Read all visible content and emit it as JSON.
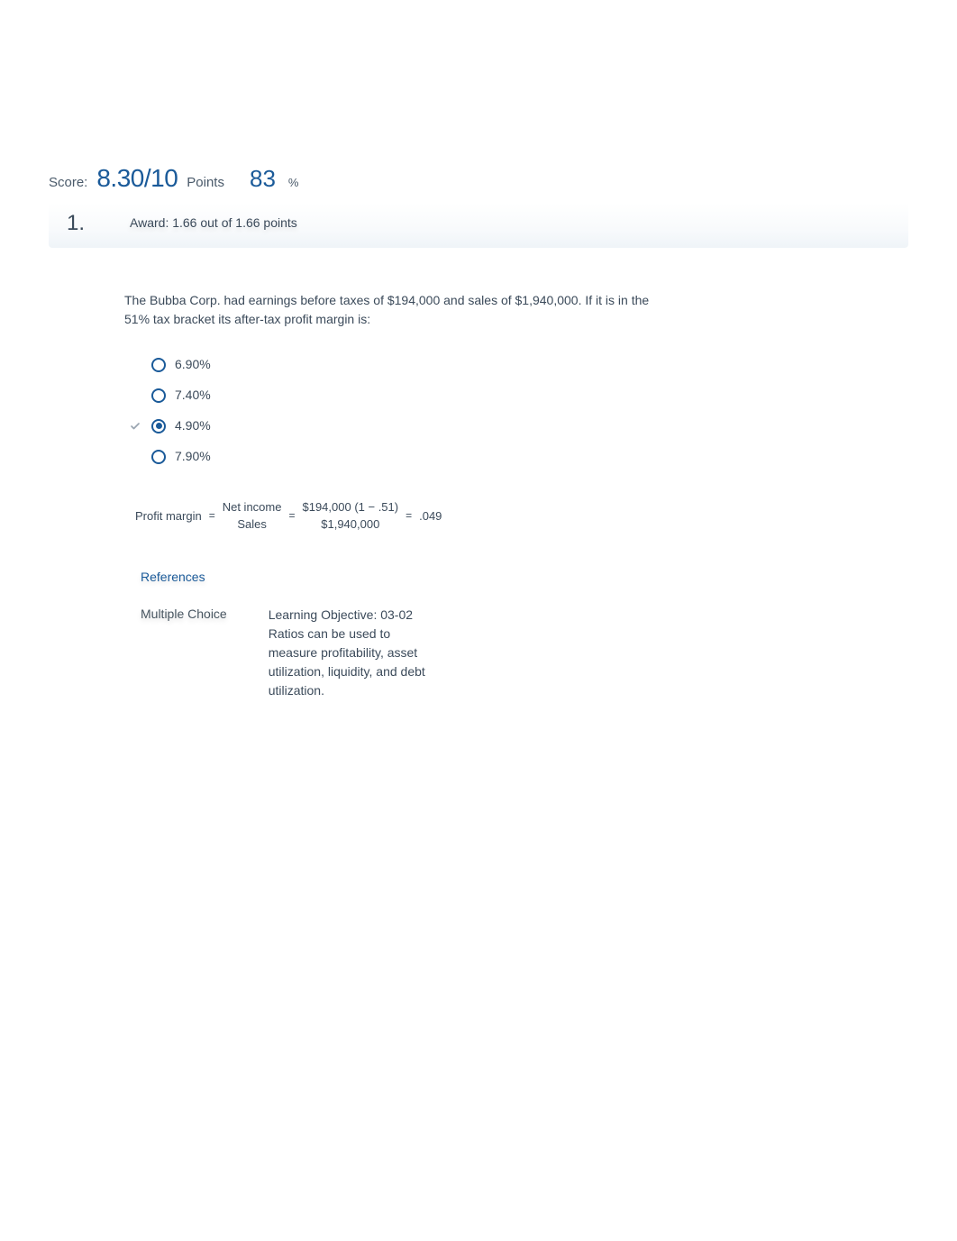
{
  "score": {
    "label": "Score:",
    "value": "8.30/10",
    "points_label": "Points",
    "percent": "83",
    "percent_sym": "%"
  },
  "question": {
    "number": "1.",
    "award_text": "Award: 1.66 out of 1.66 points",
    "text": "The Bubba Corp. had earnings before taxes of $194,000 and sales of $1,940,000. If it is in the 51% tax bracket its after-tax profit margin is:",
    "options": [
      {
        "label": "6.90%",
        "selected": false,
        "correct": false
      },
      {
        "label": "7.40%",
        "selected": false,
        "correct": false
      },
      {
        "label": "4.90%",
        "selected": true,
        "correct": true
      },
      {
        "label": "7.90%",
        "selected": false,
        "correct": false
      }
    ],
    "formula": {
      "lhs": "Profit margin",
      "eq": "=",
      "frac1_num": "Net income",
      "frac1_den": "Sales",
      "frac2_num": "$194,000 (1 − .51)",
      "frac2_den": "$1,940,000",
      "rhs": ".049"
    },
    "references_label": "References",
    "type_label": "Multiple Choice",
    "learning_objective": "Learning Objective: 03-02 Ratios can be used to measure profitability, asset utilization, liquidity, and debt utilization."
  }
}
